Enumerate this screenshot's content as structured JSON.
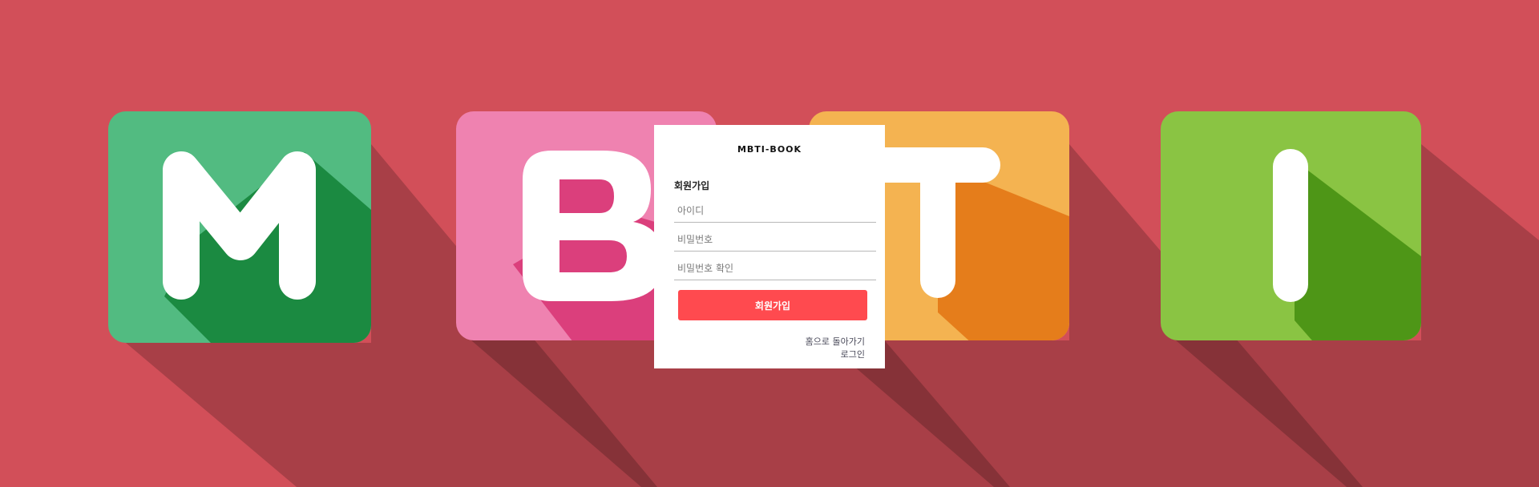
{
  "background": {
    "color": "#d24f59",
    "tiles": [
      {
        "letter": "M",
        "color": "#52bb81",
        "shadow_color": "#1b8a41"
      },
      {
        "letter": "B",
        "color": "#ef82b0",
        "shadow_color": "#db3f7c"
      },
      {
        "letter": "T",
        "color": "#f4b351",
        "shadow_color": "#e57d1b"
      },
      {
        "letter": "I",
        "color": "#8ac443",
        "shadow_color": "#4e9617"
      }
    ]
  },
  "card": {
    "brand": "MBTI-BOOK",
    "heading": "회원가입",
    "fields": {
      "id_placeholder": "아이디",
      "password_placeholder": "비밀번호",
      "password_confirm_placeholder": "비밀번호 확인"
    },
    "submit_label": "회원가입",
    "submit_color": "#ff4a4f",
    "links": {
      "home": "홈으로 돌아가기",
      "login": "로그인"
    }
  }
}
